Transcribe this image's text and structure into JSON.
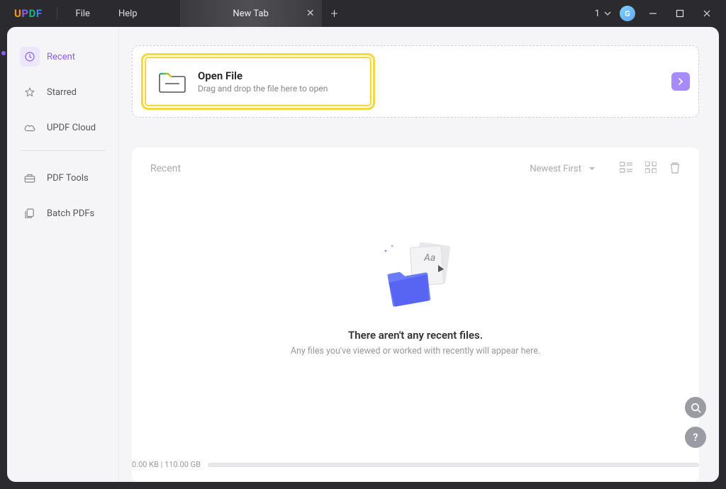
{
  "titlebar": {
    "logo": {
      "u": "U",
      "p": "P",
      "d": "D",
      "f": "F"
    },
    "menu": {
      "file": "File",
      "help": "Help"
    },
    "tab": {
      "label": "New Tab"
    },
    "account": {
      "count": "1",
      "initial": "G"
    }
  },
  "sidebar": {
    "items": [
      {
        "label": "Recent"
      },
      {
        "label": "Starred"
      },
      {
        "label": "UPDF Cloud"
      },
      {
        "label": "PDF Tools"
      },
      {
        "label": "Batch PDFs"
      }
    ]
  },
  "open": {
    "title": "Open File",
    "subtitle": "Drag and drop the file here to open"
  },
  "recent": {
    "title": "Recent",
    "sort": "Newest First",
    "empty_title": "There aren't any recent files.",
    "empty_sub": "Any files you've viewed or worked with recently will appear here."
  },
  "storage": {
    "text": "0.00 KB | 110.00 GB"
  }
}
